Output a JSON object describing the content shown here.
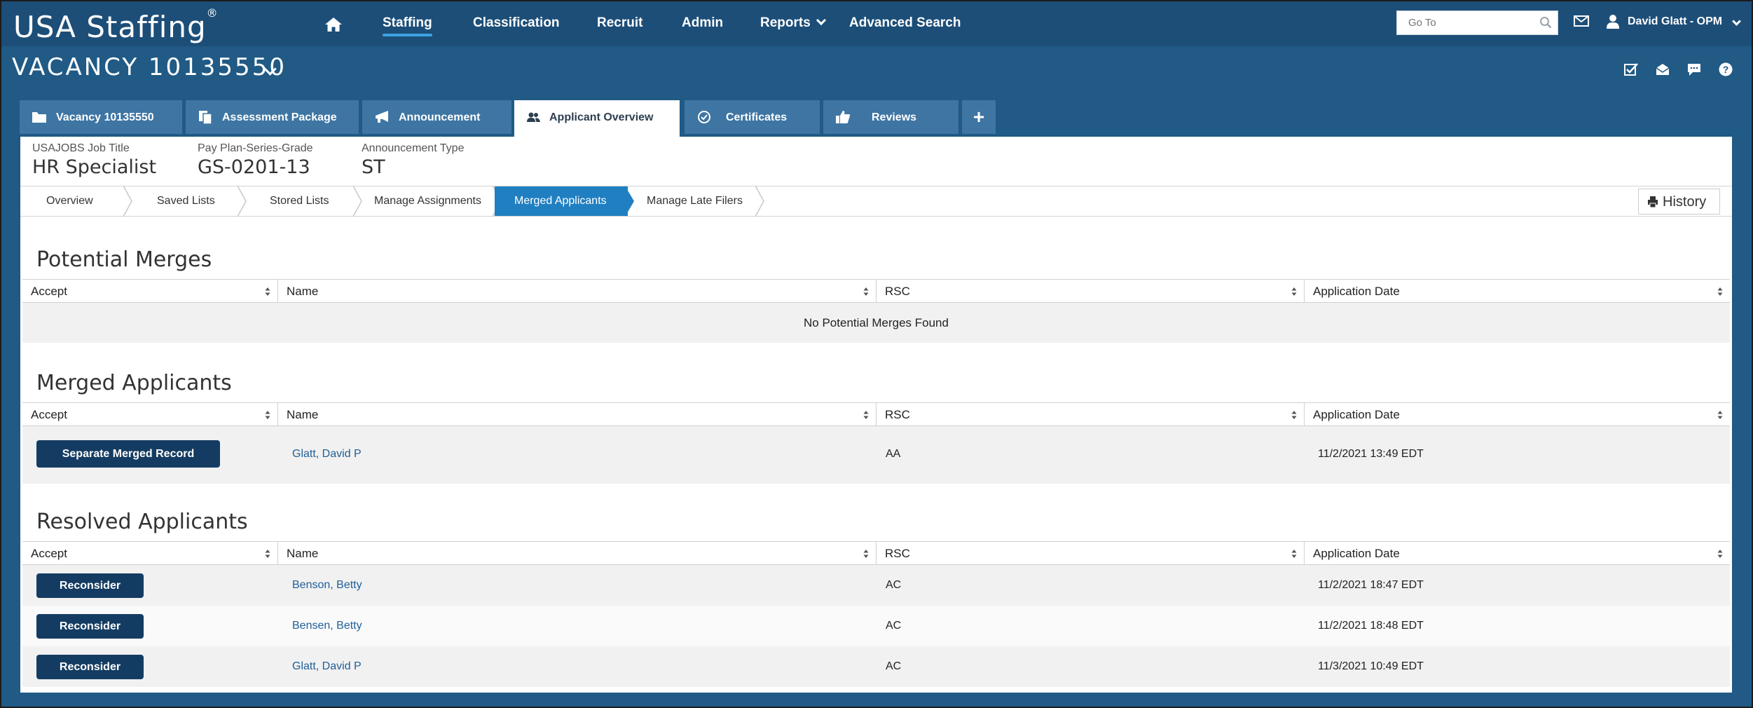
{
  "app": {
    "logo_text": "USA Staffing",
    "logo_mark": "®"
  },
  "nav": {
    "items": [
      "Staffing",
      "Classification",
      "Recruit",
      "Admin",
      "Reports",
      "Advanced Search"
    ],
    "active": "Staffing",
    "goto_placeholder": "Go To",
    "user_name": "David Glatt - OPM"
  },
  "vacancy": {
    "title": "VACANCY 10135550"
  },
  "tabs": [
    {
      "label": "Vacancy 10135550",
      "icon": "folder-icon"
    },
    {
      "label": "Assessment Package",
      "icon": "documents-icon"
    },
    {
      "label": "Announcement",
      "icon": "megaphone-icon"
    },
    {
      "label": "Applicant Overview",
      "icon": "users-icon",
      "active": true
    },
    {
      "label": "Certificates",
      "icon": "check-circle-icon"
    },
    {
      "label": "Reviews",
      "icon": "thumbs-up-icon"
    },
    {
      "label": "+",
      "icon": "plus-icon"
    }
  ],
  "meta": {
    "job_title_label": "USAJOBS Job Title",
    "job_title": "HR Specialist",
    "grade_label": "Pay Plan-Series-Grade",
    "grade": "GS-0201-13",
    "ann_type_label": "Announcement Type",
    "ann_type": "ST"
  },
  "subnav": {
    "steps": [
      "Overview",
      "Saved Lists",
      "Stored Lists",
      "Manage Assignments",
      "Merged Applicants",
      "Manage Late Filers"
    ],
    "active": "Merged Applicants",
    "history_label": "History"
  },
  "columns": [
    "Accept",
    "Name",
    "RSC",
    "Application Date"
  ],
  "potential_merges": {
    "title": "Potential Merges",
    "empty_text": "No Potential Merges Found"
  },
  "merged_applicants": {
    "title": "Merged Applicants",
    "rows": [
      {
        "action": "Separate Merged Record",
        "name": "Glatt, David P",
        "rsc": "AA",
        "date": "11/2/2021 13:49 EDT"
      }
    ]
  },
  "resolved_applicants": {
    "title": "Resolved Applicants",
    "rows": [
      {
        "action": "Reconsider",
        "name": "Benson, Betty",
        "rsc": "AC",
        "date": "11/2/2021 18:47 EDT"
      },
      {
        "action": "Reconsider",
        "name": "Bensen, Betty",
        "rsc": "AC",
        "date": "11/2/2021 18:48 EDT"
      },
      {
        "action": "Reconsider",
        "name": "Glatt, David P",
        "rsc": "AC",
        "date": "11/3/2021 10:49 EDT"
      }
    ]
  },
  "colors": {
    "navbar": "#1c4e78",
    "background": "#205a85",
    "tab": "#3e75a3",
    "active_step": "#1f7fc1",
    "button": "#143c62",
    "link": "#205f99",
    "nav_underline": "#3ca2df"
  }
}
